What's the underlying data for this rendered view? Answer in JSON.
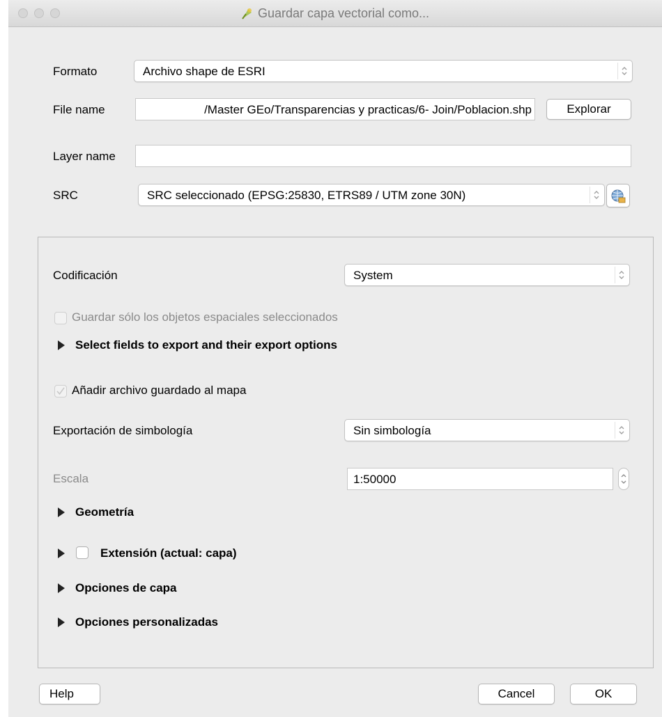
{
  "window": {
    "title": "Guardar capa vectorial como..."
  },
  "form": {
    "format_label": "Formato",
    "format_value": "Archivo shape de ESRI",
    "filename_label": "File name",
    "filename_value": "/Master GEo/Transparencias y practicas/6- Join/Poblacion.shp",
    "browse_label": "Explorar",
    "layername_label": "Layer name",
    "layername_value": "",
    "crs_label": "SRC",
    "crs_value": "SRC seleccionado (EPSG:25830, ETRS89 / UTM zone 30N)"
  },
  "panel": {
    "encoding_label": "Codificación",
    "encoding_value": "System",
    "save_selected_label": "Guardar sólo los objetos espaciales seleccionados",
    "select_fields_label": "Select fields to export and their export options",
    "add_to_map_label": "Añadir archivo guardado al mapa",
    "symbology_label": "Exportación de simbología",
    "symbology_value": "Sin simbología",
    "scale_label": "Escala",
    "scale_value": "1:50000",
    "geometry_label": "Geometría",
    "extent_label": "Extensión (actual: capa)",
    "layer_options_label": "Opciones de capa",
    "custom_options_label": "Opciones personalizadas"
  },
  "footer": {
    "help": "Help",
    "cancel": "Cancel",
    "ok": "OK"
  }
}
